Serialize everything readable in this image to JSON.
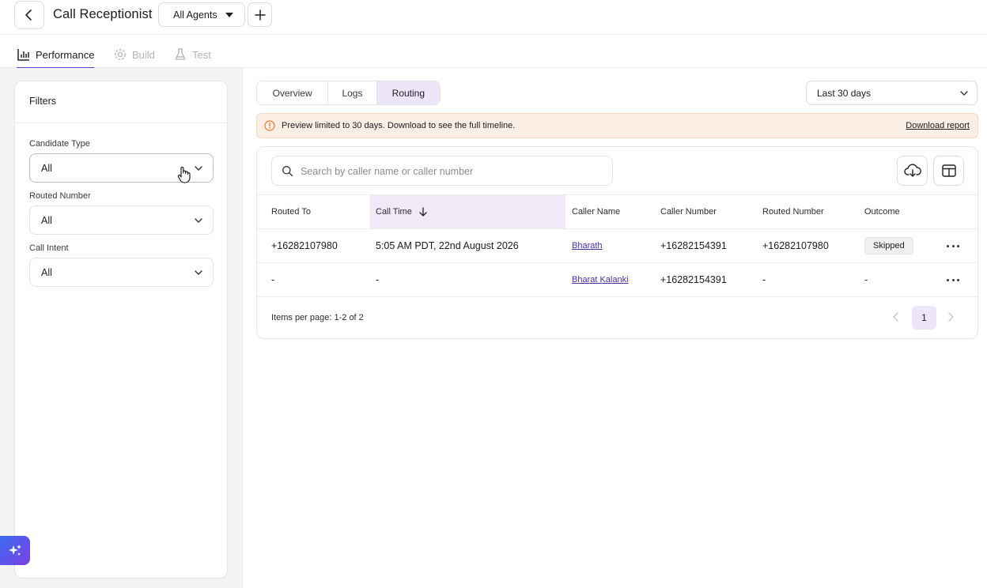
{
  "header": {
    "title": "Call Receptionist",
    "agent_select": "All Agents"
  },
  "main_tabs": [
    {
      "label": "Performance",
      "icon": "bar-chart-icon",
      "active": true
    },
    {
      "label": "Build",
      "icon": "gear-icon",
      "active": false
    },
    {
      "label": "Test",
      "icon": "flask-icon",
      "active": false
    }
  ],
  "filters": {
    "title": "Filters",
    "items": [
      {
        "label": "Candidate Type",
        "value": "All"
      },
      {
        "label": "Routed Number",
        "value": "All"
      },
      {
        "label": "Call Intent",
        "value": "All"
      }
    ]
  },
  "sub_tabs": [
    {
      "label": "Overview",
      "active": false
    },
    {
      "label": "Logs",
      "active": false
    },
    {
      "label": "Routing",
      "active": true
    }
  ],
  "date_range": "Last 30 days",
  "banner": {
    "message": "Preview limited to 30 days. Download to see the full timeline.",
    "link": "Download report"
  },
  "search": {
    "placeholder": "Search by caller name or caller number",
    "value": ""
  },
  "table": {
    "columns": [
      "Routed To",
      "Call Time",
      "Caller Name",
      "Caller Number",
      "Routed Number",
      "Outcome"
    ],
    "sorted_column": "Call Time",
    "rows": [
      {
        "routed_to": "+16282107980",
        "call_time": "5:05 AM PDT, 22nd August 2026",
        "caller_name": "Bharath",
        "caller_number": "+16282154391",
        "routed_number": "+16282107980",
        "outcome": "Skipped"
      },
      {
        "routed_to": "-",
        "call_time": "-",
        "caller_name": "Bharat Kalanki",
        "caller_number": "+16282154391",
        "routed_number": "-",
        "outcome": "-"
      }
    ]
  },
  "pagination": {
    "summary": "Items per page: 1-2 of 2",
    "current_page": "1"
  },
  "colors": {
    "accent": "#5b3fd0",
    "active_tab_bg": "#ece6f8",
    "banner_bg": "#fbeee4",
    "link": "#4a2fa8"
  }
}
